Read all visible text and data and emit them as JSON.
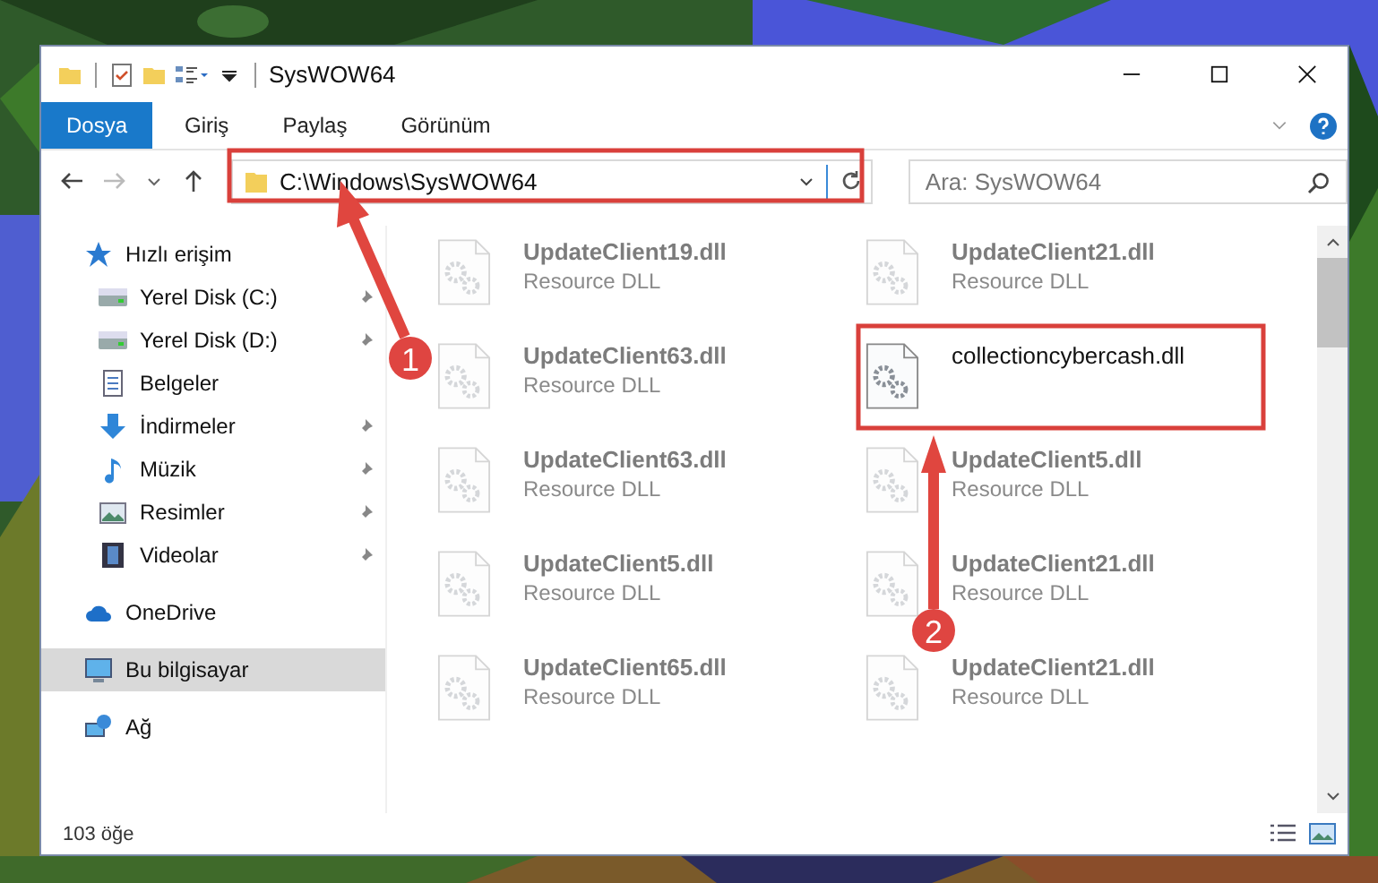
{
  "window": {
    "title": "SysWOW64"
  },
  "ribbon_tabs": [
    {
      "label": "Dosya",
      "selected": true
    },
    {
      "label": "Giriş",
      "selected": false
    },
    {
      "label": "Paylaş",
      "selected": false
    },
    {
      "label": "Görünüm",
      "selected": false
    }
  ],
  "address": {
    "path": "C:\\Windows\\SysWOW64"
  },
  "search": {
    "placeholder": "Ara: SysWOW64"
  },
  "sidebar": {
    "items": [
      {
        "label": "Hızlı erişim",
        "kind": "star",
        "selected": false,
        "children": [
          {
            "label": "Yerel Disk (C:)",
            "kind": "drive",
            "pinned": true,
            "selected": false
          },
          {
            "label": "Yerel Disk (D:)",
            "kind": "drive",
            "pinned": true,
            "selected": false
          },
          {
            "label": "Belgeler",
            "kind": "document",
            "pinned": false,
            "selected": false
          },
          {
            "label": "İndirmeler",
            "kind": "download",
            "pinned": true,
            "selected": false
          },
          {
            "label": "Müzik",
            "kind": "music",
            "pinned": true,
            "selected": false
          },
          {
            "label": "Resimler",
            "kind": "pictures",
            "pinned": true,
            "selected": false
          },
          {
            "label": "Videolar",
            "kind": "video",
            "pinned": true,
            "selected": false
          }
        ]
      },
      {
        "label": "OneDrive",
        "kind": "cloud",
        "selected": false
      },
      {
        "label": "Bu bilgisayar",
        "kind": "computer",
        "selected": true
      },
      {
        "label": "Ağ",
        "kind": "network",
        "selected": false
      }
    ]
  },
  "files": [
    {
      "name": "UpdateClient19.dll",
      "type": "Resource DLL",
      "dimmed": true
    },
    {
      "name": "UpdateClient21.dll",
      "type": "Resource DLL",
      "dimmed": true
    },
    {
      "name": "UpdateClient63.dll",
      "type": "Resource DLL",
      "dimmed": true
    },
    {
      "name": "collectioncybercash.dll",
      "dimmed": false
    },
    {
      "name": "UpdateClient63.dll",
      "type": "Resource DLL",
      "dimmed": true
    },
    {
      "name": "UpdateClient5.dll",
      "type": "Resource DLL",
      "dimmed": true
    },
    {
      "name": "UpdateClient5.dll",
      "type": "Resource DLL",
      "dimmed": true
    },
    {
      "name": "UpdateClient21.dll",
      "type": "Resource DLL",
      "dimmed": true
    },
    {
      "name": "UpdateClient65.dll",
      "type": "Resource DLL",
      "dimmed": true
    },
    {
      "name": "UpdateClient21.dll",
      "type": "Resource DLL",
      "dimmed": true
    }
  ],
  "status_bar": {
    "count": "103 öğe"
  },
  "annotations": [
    {
      "label": "1"
    },
    {
      "label": "2"
    }
  ]
}
